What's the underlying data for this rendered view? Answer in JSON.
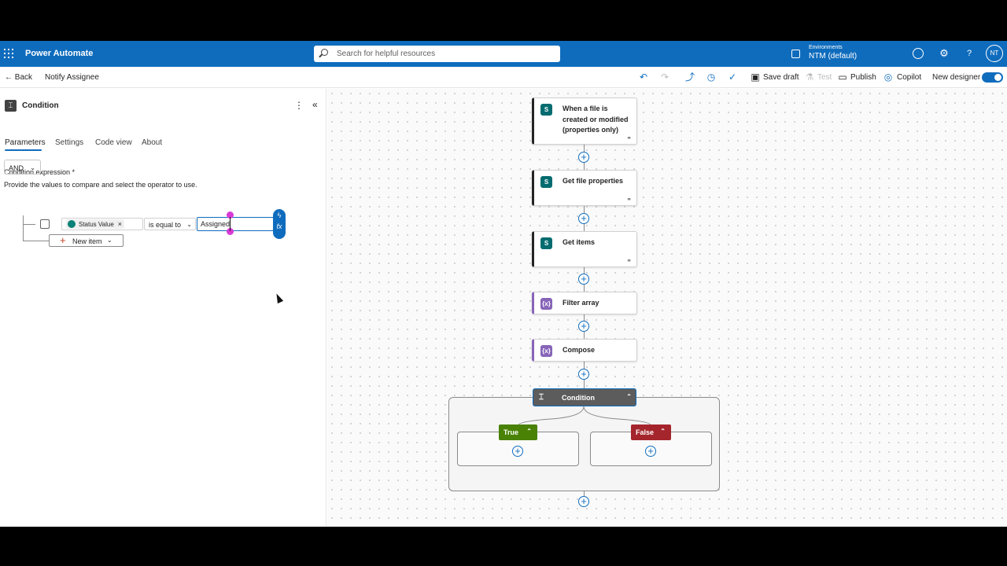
{
  "app": {
    "title": "Power Automate"
  },
  "search": {
    "placeholder": "Search for helpful resources"
  },
  "environment": {
    "label": "Environments",
    "value": "NTM (default)"
  },
  "user": {
    "initials": "NT"
  },
  "cmdbar": {
    "back_label": "Back",
    "flow_name": "Notify Assignee",
    "save_draft": "Save draft",
    "test": "Test",
    "publish": "Publish",
    "copilot": "Copilot",
    "new_designer": "New designer",
    "new_designer_on": true
  },
  "panel": {
    "title": "Condition",
    "tabs": [
      "Parameters",
      "Settings",
      "Code view",
      "About"
    ],
    "active_tab": "Parameters",
    "expr_label": "Condition expression *",
    "expr_desc": "Provide the values to compare and select the operator to use.",
    "group_operator": "AND",
    "row": {
      "token": "Status Value",
      "operator": "is equal to",
      "value": "Assigned"
    },
    "new_item": "New item"
  },
  "flow": {
    "steps": [
      {
        "label": "When a file is created or modified (properties only)",
        "icon": "sharepoint-icon"
      },
      {
        "label": "Get file properties",
        "icon": "sharepoint-icon"
      },
      {
        "label": "Get items",
        "icon": "sharepoint-icon"
      },
      {
        "label": "Filter array",
        "icon": "data-operation-icon"
      },
      {
        "label": "Compose",
        "icon": "data-operation-icon"
      }
    ],
    "condition": {
      "label": "Condition",
      "true_label": "True",
      "false_label": "False"
    }
  },
  "colors": {
    "brand": "#0f6cbd",
    "true_branch": "#498205",
    "false_branch": "#a4262c",
    "sharepoint": "#036c70",
    "data_operation": "#8764b8"
  }
}
